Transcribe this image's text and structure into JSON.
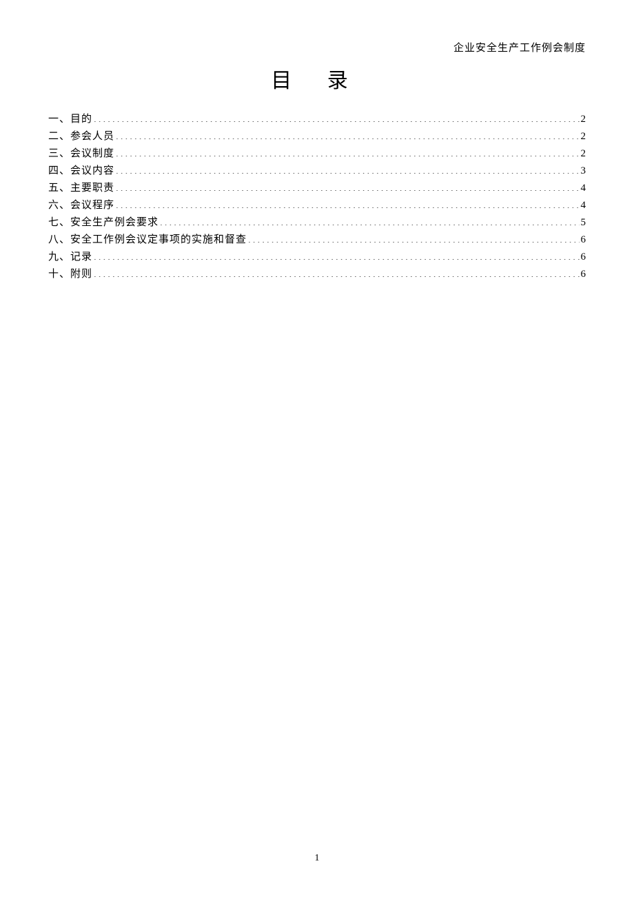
{
  "header_note": "企业安全生产工作例会制度",
  "title": "目  录",
  "toc": [
    {
      "label": "一、目的",
      "page": "2"
    },
    {
      "label": "二、参会人员",
      "page": "2"
    },
    {
      "label": "三、会议制度",
      "page": "2"
    },
    {
      "label": "四、会议内容",
      "page": "3"
    },
    {
      "label": "五、主要职责",
      "page": "4"
    },
    {
      "label": "六、会议程序",
      "page": "4"
    },
    {
      "label": "七、安全生产例会要求",
      "page": "5"
    },
    {
      "label": "八、安全工作例会议定事项的实施和督查",
      "page": "6"
    },
    {
      "label": "九、记录",
      "page": "6"
    },
    {
      "label": "十、附则",
      "page": "6"
    }
  ],
  "page_number": "1"
}
